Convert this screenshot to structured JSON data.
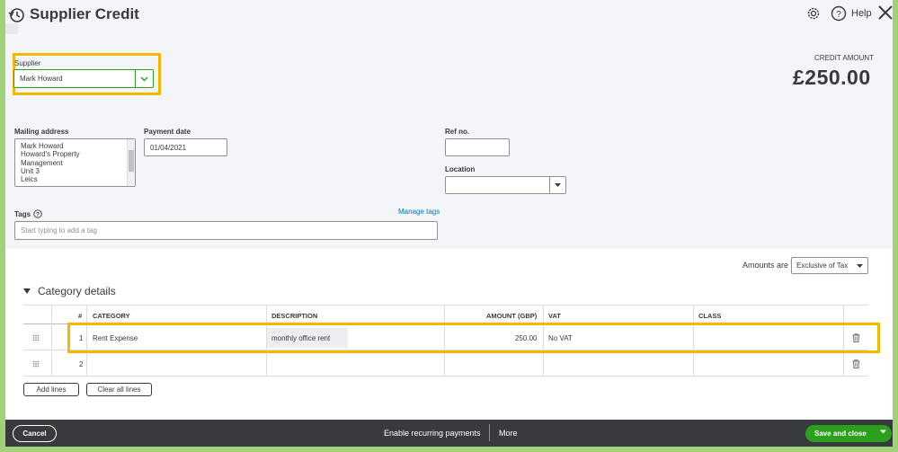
{
  "header": {
    "title": "Supplier Credit",
    "help_label": "Help"
  },
  "supplier": {
    "label": "Supplier",
    "value": "Mark Howard"
  },
  "credit": {
    "label": "CREDIT AMOUNT",
    "amount": "£250.00"
  },
  "mailing": {
    "label": "Mailing address",
    "lines": [
      "Mark Howard",
      "Howard's Property",
      "Management",
      "Unit 3",
      "Leics"
    ]
  },
  "payment_date": {
    "label": "Payment date",
    "value": "01/04/2021"
  },
  "ref_no": {
    "label": "Ref no.",
    "value": ""
  },
  "location": {
    "label": "Location",
    "value": ""
  },
  "tags": {
    "label": "Tags",
    "manage_label": "Manage tags",
    "placeholder": "Start typing to add a tag"
  },
  "amounts": {
    "label": "Amounts are",
    "value": "Exclusive of Tax"
  },
  "category_details": {
    "title": "Category details",
    "columns": [
      "#",
      "CATEGORY",
      "DESCRIPTION",
      "AMOUNT (GBP)",
      "VAT",
      "CLASS"
    ],
    "rows": [
      {
        "num": "1",
        "category": "Rent Expense",
        "description": "monthly office rent",
        "amount": "250.00",
        "vat": "No VAT",
        "class": ""
      },
      {
        "num": "2",
        "category": "",
        "description": "",
        "amount": "",
        "vat": "",
        "class": ""
      }
    ],
    "add_lines_label": "Add lines",
    "clear_lines_label": "Clear all lines"
  },
  "footer": {
    "cancel_label": "Cancel",
    "recurring_label": "Enable recurring payments",
    "more_label": "More",
    "save_label": "Save and close"
  },
  "colors": {
    "accent_green": "#2ca01c",
    "highlight": "#f5b800",
    "footer_bg": "#393a3d"
  }
}
